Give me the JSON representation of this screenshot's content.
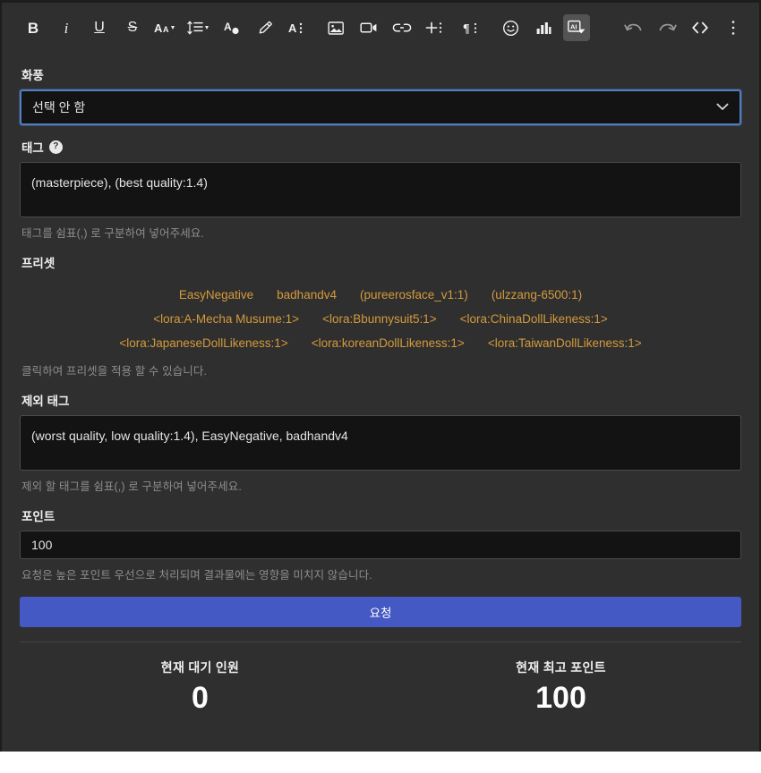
{
  "toolbar": {
    "items": [
      {
        "name": "bold-icon",
        "label": "B",
        "kind": "text-bold"
      },
      {
        "name": "italic-icon",
        "label": "i",
        "kind": "text-italic"
      },
      {
        "name": "underline-icon",
        "label": "U",
        "kind": "text-underline"
      },
      {
        "name": "strikethrough-icon",
        "label": "S",
        "kind": "text-strike"
      },
      {
        "name": "font-size-icon",
        "label": "Aa",
        "kind": "svg"
      },
      {
        "name": "line-height-icon",
        "label": "",
        "kind": "svg"
      },
      {
        "name": "text-color-icon",
        "label": "",
        "kind": "svg"
      },
      {
        "name": "highlight-icon",
        "label": "",
        "kind": "svg"
      },
      {
        "name": "text-style-icon",
        "label": "A",
        "kind": "svg"
      },
      {
        "name": "image-icon",
        "label": "",
        "kind": "svg"
      },
      {
        "name": "video-icon",
        "label": "",
        "kind": "svg"
      },
      {
        "name": "link-icon",
        "label": "",
        "kind": "svg"
      },
      {
        "name": "insert-more-icon",
        "label": "",
        "kind": "svg"
      },
      {
        "name": "paragraph-icon",
        "label": "",
        "kind": "svg"
      },
      {
        "name": "emoji-icon",
        "label": "",
        "kind": "svg"
      },
      {
        "name": "poll-icon",
        "label": "",
        "kind": "svg"
      },
      {
        "name": "ai-icon",
        "label": "AI",
        "kind": "svg",
        "active": true
      },
      {
        "name": "undo-icon",
        "label": "",
        "kind": "svg"
      },
      {
        "name": "redo-icon",
        "label": "",
        "kind": "svg"
      },
      {
        "name": "code-icon",
        "label": "",
        "kind": "svg"
      },
      {
        "name": "more-options-icon",
        "label": "",
        "kind": "svg"
      }
    ]
  },
  "style_field": {
    "label": "화풍",
    "selected": "선택 안 함"
  },
  "tag_field": {
    "label": "태그",
    "help_glyph": "?",
    "value": "(masterpiece), (best quality:1.4)",
    "hint": "태그를 쉼표(,) 로 구분하여 넣어주세요."
  },
  "preset": {
    "label": "프리셋",
    "hint": "클릭하여 프리셋을 적용 할 수 있습니다.",
    "rows": [
      [
        "EasyNegative",
        "badhandv4",
        "(pureerosface_v1:1)",
        "(ulzzang-6500:1)"
      ],
      [
        "<lora:A-Mecha Musume:1>",
        "<lora:Bbunnysuit5:1>",
        "<lora:ChinaDollLikeness:1>"
      ],
      [
        "<lora:JapaneseDollLikeness:1>",
        "<lora:koreanDollLikeness:1>",
        "<lora:TaiwanDollLikeness:1>"
      ]
    ]
  },
  "exclude_field": {
    "label": "제외 태그",
    "value": "(worst quality, low quality:1.4), EasyNegative, badhandv4",
    "hint": "제외 할 태그를 쉼표(,) 로 구분하여 넣어주세요."
  },
  "point_field": {
    "label": "포인트",
    "value": "100",
    "hint": "요청은 높은 포인트 우선으로 처리되며 결과물에는 영향을 미치지 않습니다."
  },
  "submit": {
    "label": "요청"
  },
  "stats": [
    {
      "label": "현재 대기 인원",
      "value": "0"
    },
    {
      "label": "현재 최고 포인트",
      "value": "100"
    }
  ],
  "colors": {
    "app_bg": "#2f2f2f",
    "input_bg": "#131313",
    "accent_blue": "#4559c4",
    "focus_blue": "#4f7fc0",
    "preset_orange": "#d59a3b",
    "hint_gray": "#8d8d8d"
  }
}
